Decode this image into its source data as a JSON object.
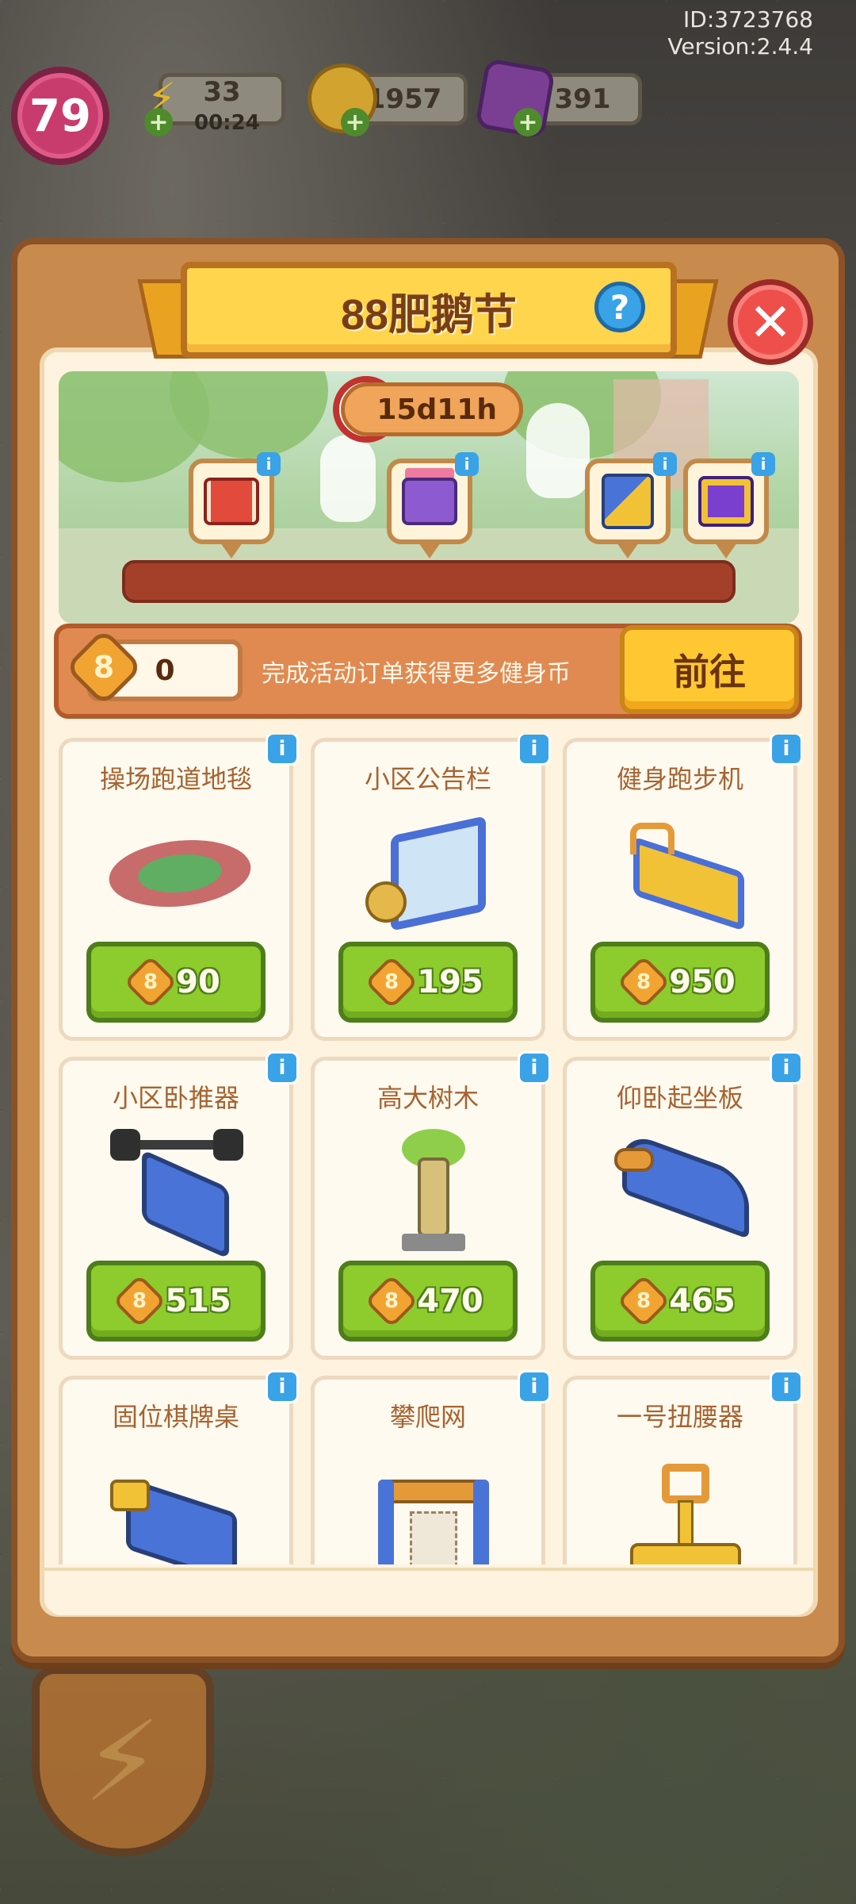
{
  "hud": {
    "player_id": "ID:3723768",
    "version": "Version:2.4.4",
    "level": "79",
    "energy": {
      "value": "33",
      "timer": "00:24",
      "icon": "lightning-icon"
    },
    "coins": {
      "value": "1957",
      "icon": "gold-coin-icon"
    },
    "gems": {
      "value": "391",
      "icon": "purple-gem-icon"
    }
  },
  "panel": {
    "title": "88肥鹅节",
    "help_label": "?",
    "close_label": "✕",
    "timer": "15d11h",
    "rewards": [
      {
        "icon": "red-gift-box-icon",
        "info": "i"
      },
      {
        "icon": "pink-gift-box-icon",
        "info": "i"
      },
      {
        "icon": "playground-slide-icon",
        "info": "i"
      },
      {
        "icon": "purple-gift-box-icon",
        "info": "i"
      }
    ],
    "progress": 0,
    "coin_icon_label": "8",
    "coin_count": "0",
    "coin_hint": "完成活动订单获得更多健身币",
    "goto_label": "前往"
  },
  "shop_items": [
    {
      "name": "操场跑道地毯",
      "price": "90",
      "icon": "running-track-icon"
    },
    {
      "name": "小区公告栏",
      "price": "195",
      "icon": "bulletin-board-icon"
    },
    {
      "name": "健身跑步机",
      "price": "950",
      "icon": "treadmill-icon"
    },
    {
      "name": "小区卧推器",
      "price": "515",
      "icon": "bench-press-icon"
    },
    {
      "name": "高大树木",
      "price": "470",
      "icon": "tall-tree-icon"
    },
    {
      "name": "仰卧起坐板",
      "price": "465",
      "icon": "situp-board-icon"
    },
    {
      "name": "固位棋牌桌",
      "price": "",
      "icon": "chess-table-icon"
    },
    {
      "name": "攀爬网",
      "price": "",
      "icon": "climbing-net-icon"
    },
    {
      "name": "一号扭腰器",
      "price": "",
      "icon": "waist-twister-icon"
    }
  ],
  "item_info_label": "i",
  "item_coin_label": "8",
  "colors": {
    "panel_wood": "#c98a4e",
    "panel_cream": "#fdf3df",
    "title_yellow": "#ffd54d",
    "price_green": "#8ecb2c",
    "info_blue": "#3aa2e6",
    "close_red": "#ef4f4a",
    "coin_orange": "#f2a433"
  }
}
